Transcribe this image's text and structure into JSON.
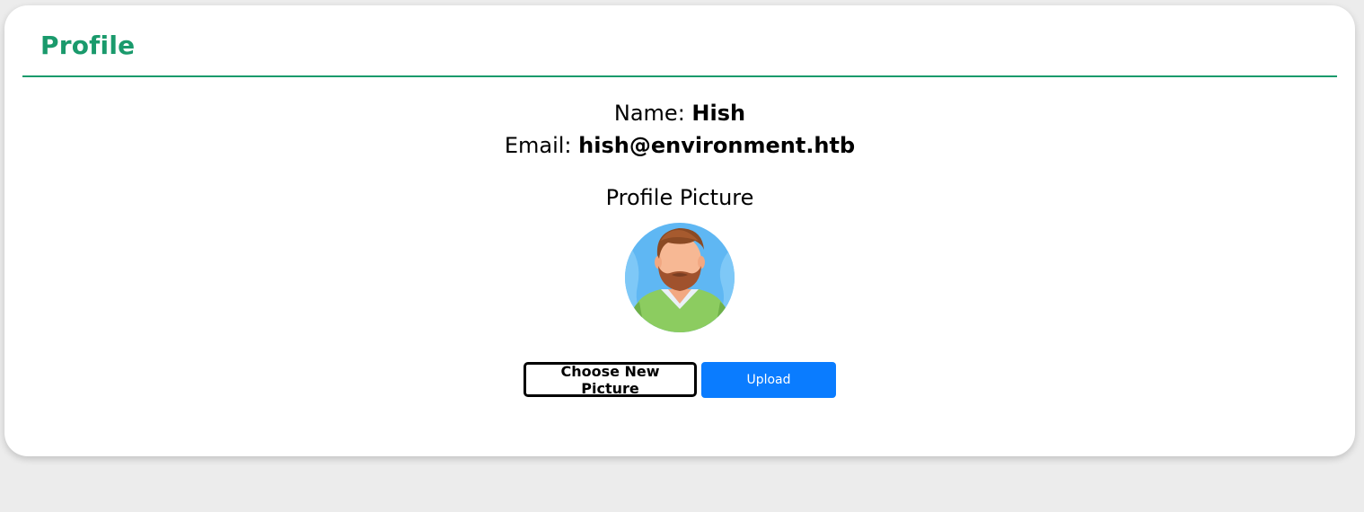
{
  "card": {
    "title": "Profile"
  },
  "profile": {
    "name_label": "Name:",
    "name_value": "Hish",
    "email_label": "Email:",
    "email_value": "hish@environment.htb"
  },
  "picture": {
    "heading": "Profile Picture",
    "avatar_icon": "avatar-man-beard-icon"
  },
  "actions": {
    "choose_label": "Choose New Picture",
    "upload_label": "Upload"
  },
  "colors": {
    "accent": "#1a9a6c",
    "upload_button": "#0a7cff",
    "page_background": "#ececec"
  }
}
